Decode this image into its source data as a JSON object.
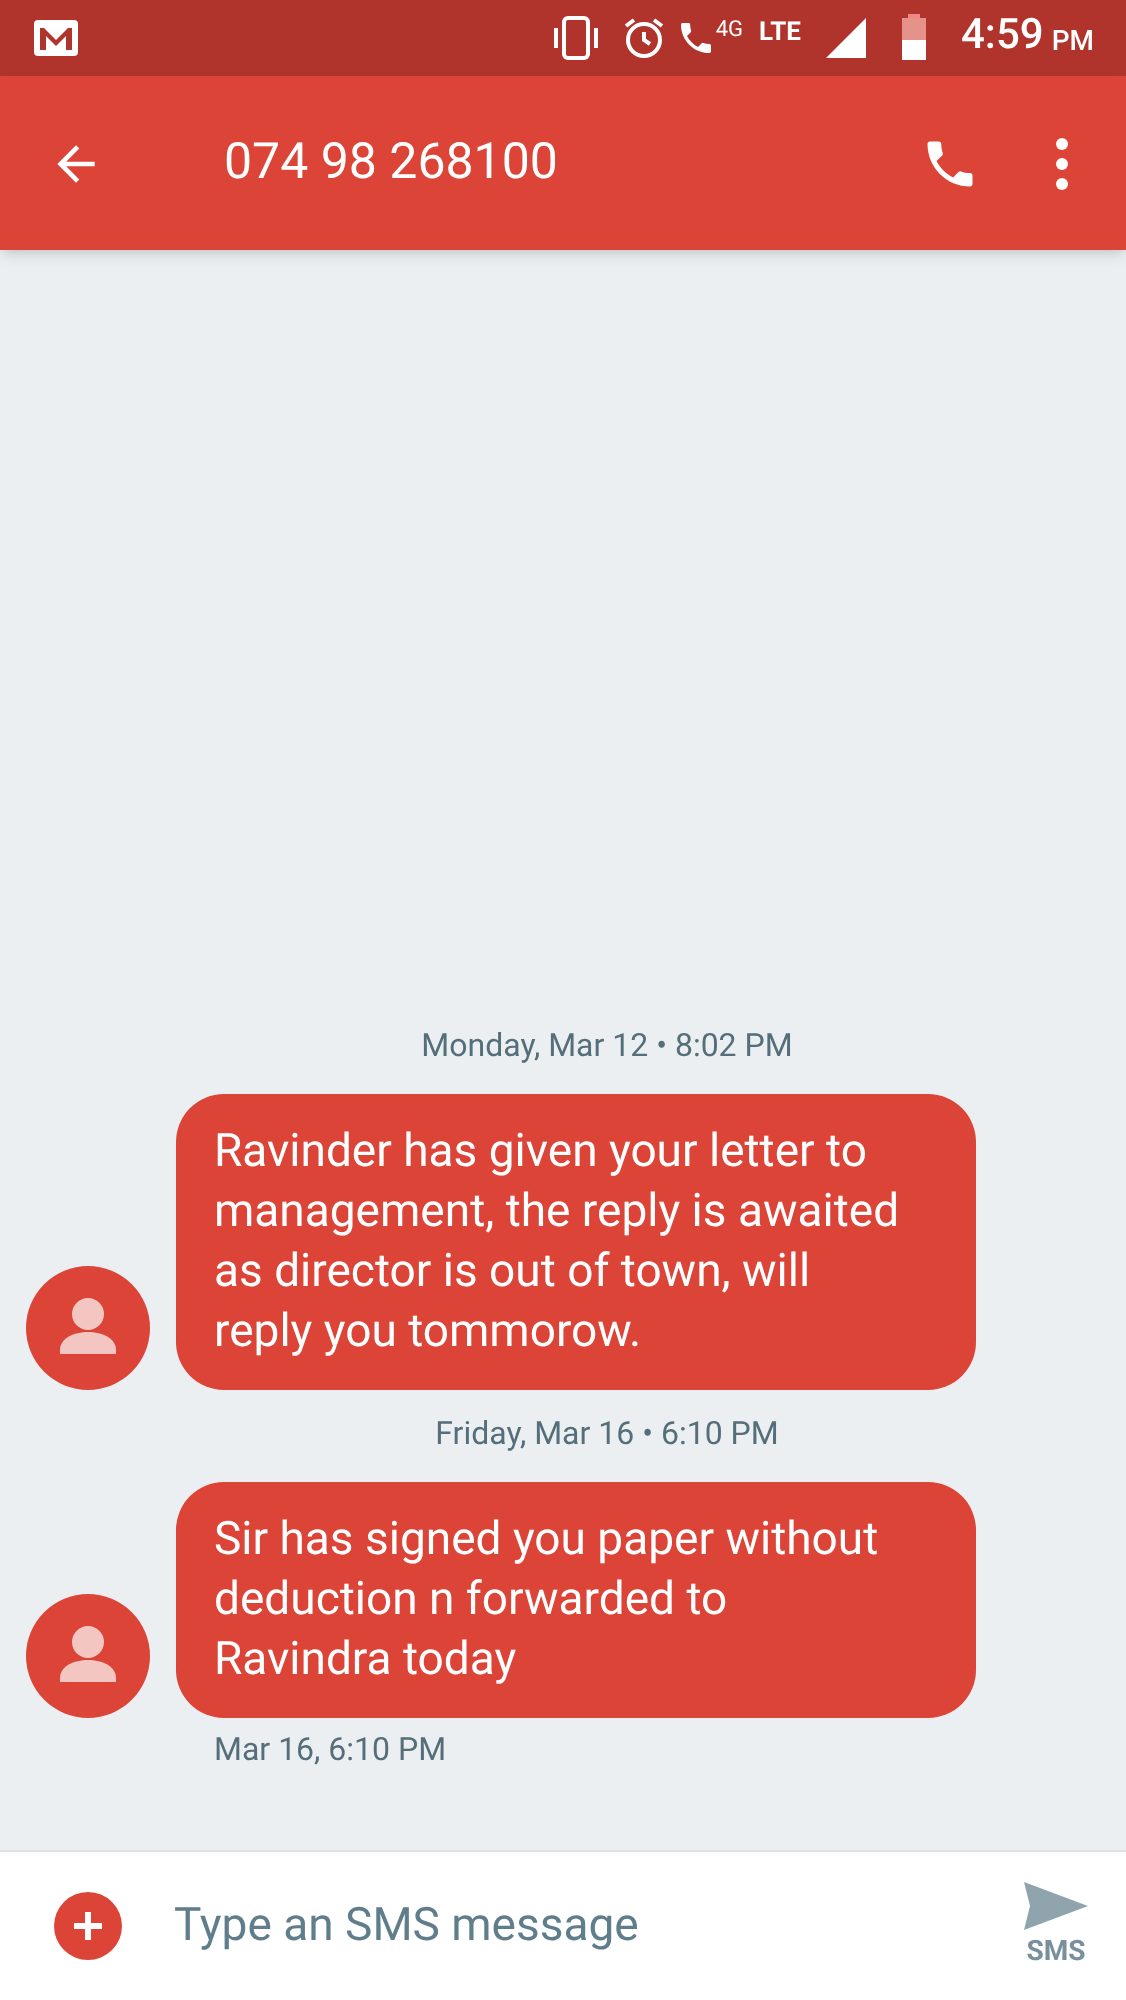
{
  "status_bar": {
    "network": "4G",
    "lte": "LTE",
    "time": "4:59",
    "ampm": "PM"
  },
  "header": {
    "title": "074 98 268100"
  },
  "conversation": [
    {
      "kind": "date",
      "text": "Monday, Mar 12 • 8:02 PM"
    },
    {
      "kind": "message",
      "text": "Ravinder has given your letter to management, the reply is awaited as director is out of town, will reply you tommorow."
    },
    {
      "kind": "date",
      "text": "Friday, Mar 16 • 6:10 PM"
    },
    {
      "kind": "message",
      "text": "Sir has signed you paper without deduction n forwarded to Ravindra today",
      "time": "Mar 16, 6:10 PM"
    }
  ],
  "composer": {
    "placeholder": "Type an SMS message",
    "send_label": "SMS"
  }
}
